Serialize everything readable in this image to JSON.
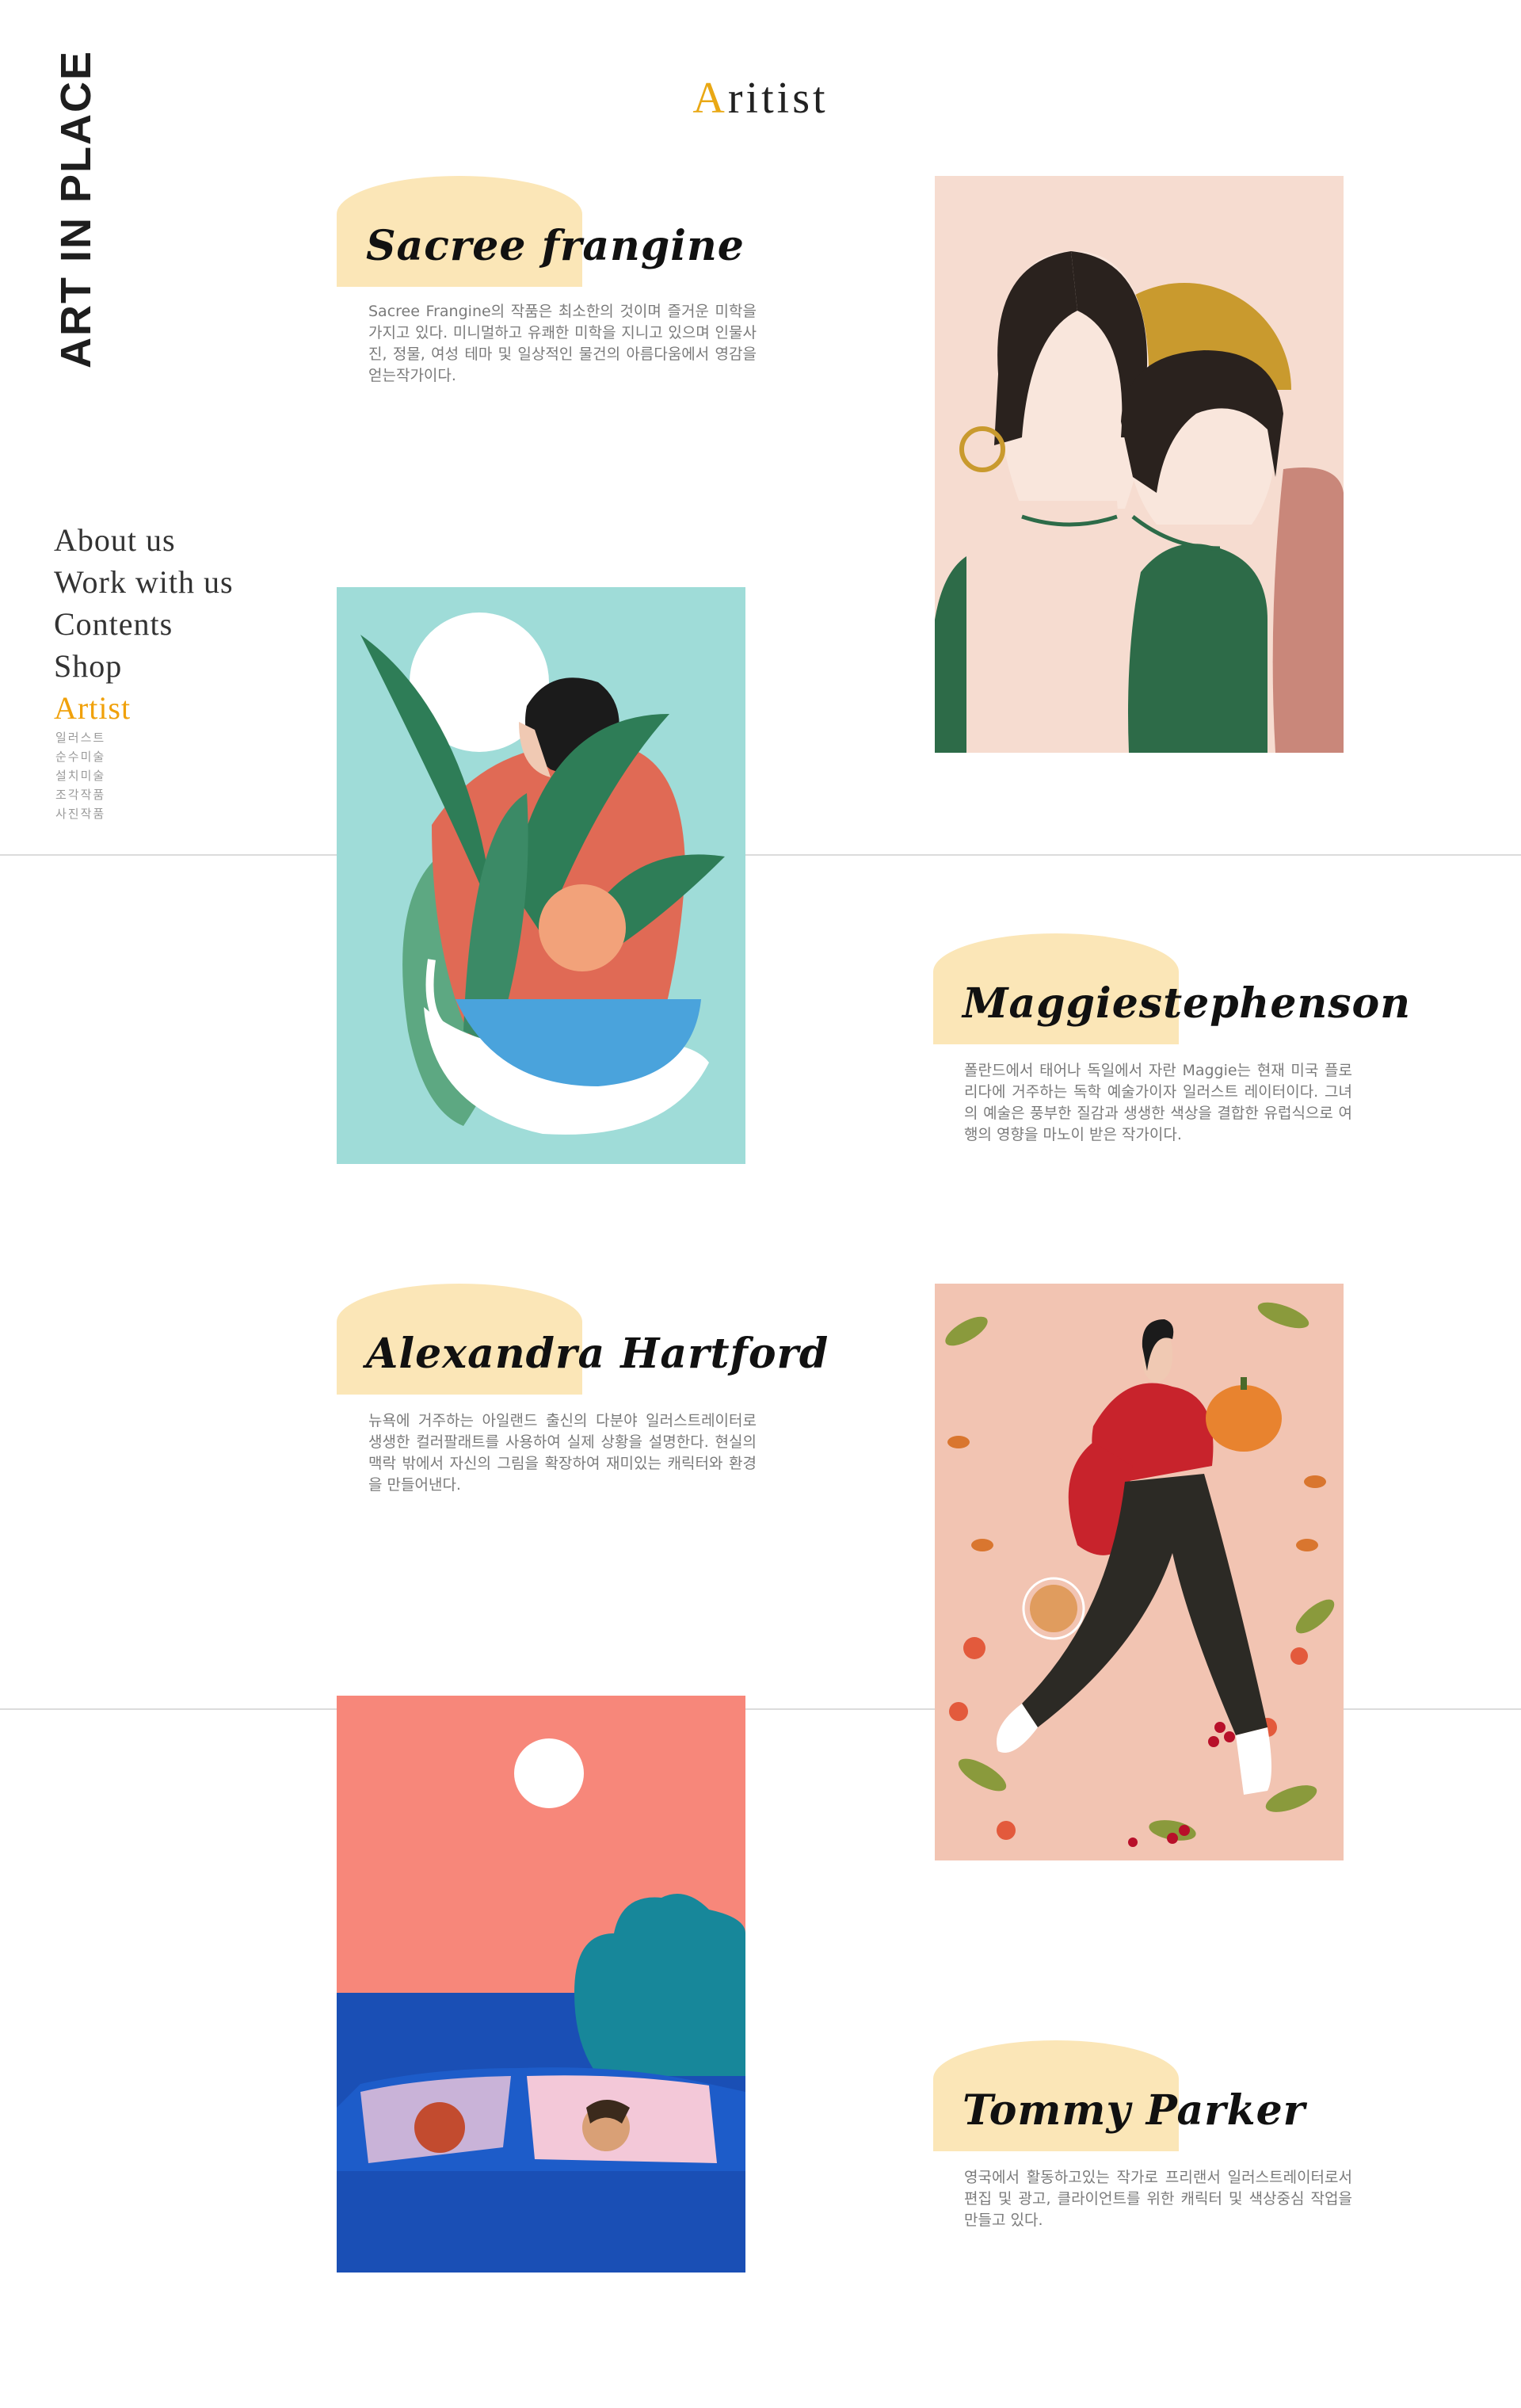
{
  "brand": {
    "logo_text": "ART IN PLACE"
  },
  "header": {
    "title_first": "A",
    "title_rest": "ritist"
  },
  "nav": {
    "items": [
      {
        "label": "About us"
      },
      {
        "label": "Work with us"
      },
      {
        "label": "Contents"
      },
      {
        "label": "Shop"
      },
      {
        "label": "Artist",
        "active": true
      }
    ],
    "sub_items": [
      {
        "label": "일러스트"
      },
      {
        "label": "순수미술"
      },
      {
        "label": "설치미술"
      },
      {
        "label": "조각작품"
      },
      {
        "label": "사진작품"
      }
    ]
  },
  "artists": [
    {
      "name": "Sacree frangine",
      "description": "Sacree Frangine의 작품은 최소한의 것이며 즐거운 미학을 가지고 있다. 미니멀하고 유쾌한 미학을 지니고 있으며 인물사진, 정물, 여성 테마 및 일상적인 물건의 아름다움에서 영감을 얻는작가이다."
    },
    {
      "name": "Maggiestephenson",
      "description": "폴란드에서 태어나 독일에서 자란 Maggie는 현재 미국 플로리다에 거주하는 독학 예술가이자 일러스트 레이터이다. 그녀의 예술은 풍부한 질감과 생생한 색상을 결합한 유럽식으로 여행의 영향을 마노이 받은 작가이다."
    },
    {
      "name": "Alexandra Hartford",
      "description": "뉴욕에 거주하는 아일랜드 출신의 다분야 일러스트레이터로 생생한 컬러팔래트를 사용하여 실제 상황을 설명한다. 현실의 맥락 밖에서 자신의 그림을 확장하여 재미있는 캐릭터와 환경을 만들어낸다."
    },
    {
      "name": "Tommy Parker",
      "description": "영국에서 활동하고있는 작가로 프리랜서 일러스트레이터로서 편집 및 광고, 클라이언트를 위한 캐릭터 및 색상중심 작업을 만들고 있다."
    }
  ],
  "artworks": [
    {
      "icon": "two-women-portrait-artwork"
    },
    {
      "icon": "embrace-plant-artwork"
    },
    {
      "icon": "woman-pumpkin-artwork"
    },
    {
      "icon": "car-by-sea-artwork"
    }
  ],
  "colors": {
    "accent": "#f0a10b",
    "title_accent": "#e9a814",
    "label_bg": "#fbe6b7",
    "text": "#333333",
    "muted": "#7a7a7a"
  }
}
